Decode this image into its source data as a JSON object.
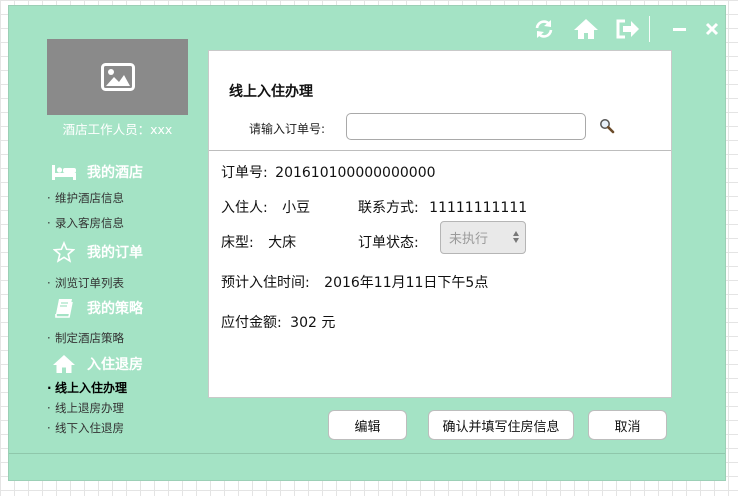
{
  "sidebar": {
    "staff_label": "酒店工作人员：xxx",
    "sections": [
      {
        "title": "我的酒店",
        "icon": "bed-icon",
        "items": [
          "维护酒店信息",
          "录入客房信息"
        ]
      },
      {
        "title": "我的订单",
        "icon": "star-icon",
        "items": [
          "浏览订单列表"
        ]
      },
      {
        "title": "我的策略",
        "icon": "book-icon",
        "items": [
          "制定酒店策略"
        ]
      },
      {
        "title": "入住退房",
        "icon": "home-icon",
        "items": [
          "线上入住办理",
          "线上退房办理",
          "线下入住退房"
        ]
      }
    ],
    "active_item": "线上入住办理",
    "bullet": "·"
  },
  "titlebar": {
    "icons": [
      "refresh-icon",
      "home-icon",
      "logout-icon",
      "minimize-icon",
      "close-icon"
    ]
  },
  "panel": {
    "title": "线上入住办理",
    "search_label": "请输入订单号:",
    "search_value": "",
    "search_icon": "magnifier-icon",
    "order_no_label": "订单号:",
    "order_no_value": "201610100000000000",
    "guest_label": "入住人:",
    "guest_value": "小豆",
    "contact_label": "联系方式:",
    "contact_value": "11111111111",
    "bed_label": "床型:",
    "bed_value": "大床",
    "status_label": "订单状态:",
    "status_value": "未执行",
    "checkin_label": "预计入住时间:",
    "checkin_value": "2016年11月11日下午5点",
    "amount_label": "应付金额:",
    "amount_value": "302 元"
  },
  "buttons": {
    "edit": "编辑",
    "confirm": "确认并填写住房信息",
    "cancel": "取消"
  },
  "colors": {
    "window_bg": "#a4e3c5",
    "avatar_bg": "#8a8a8a"
  }
}
